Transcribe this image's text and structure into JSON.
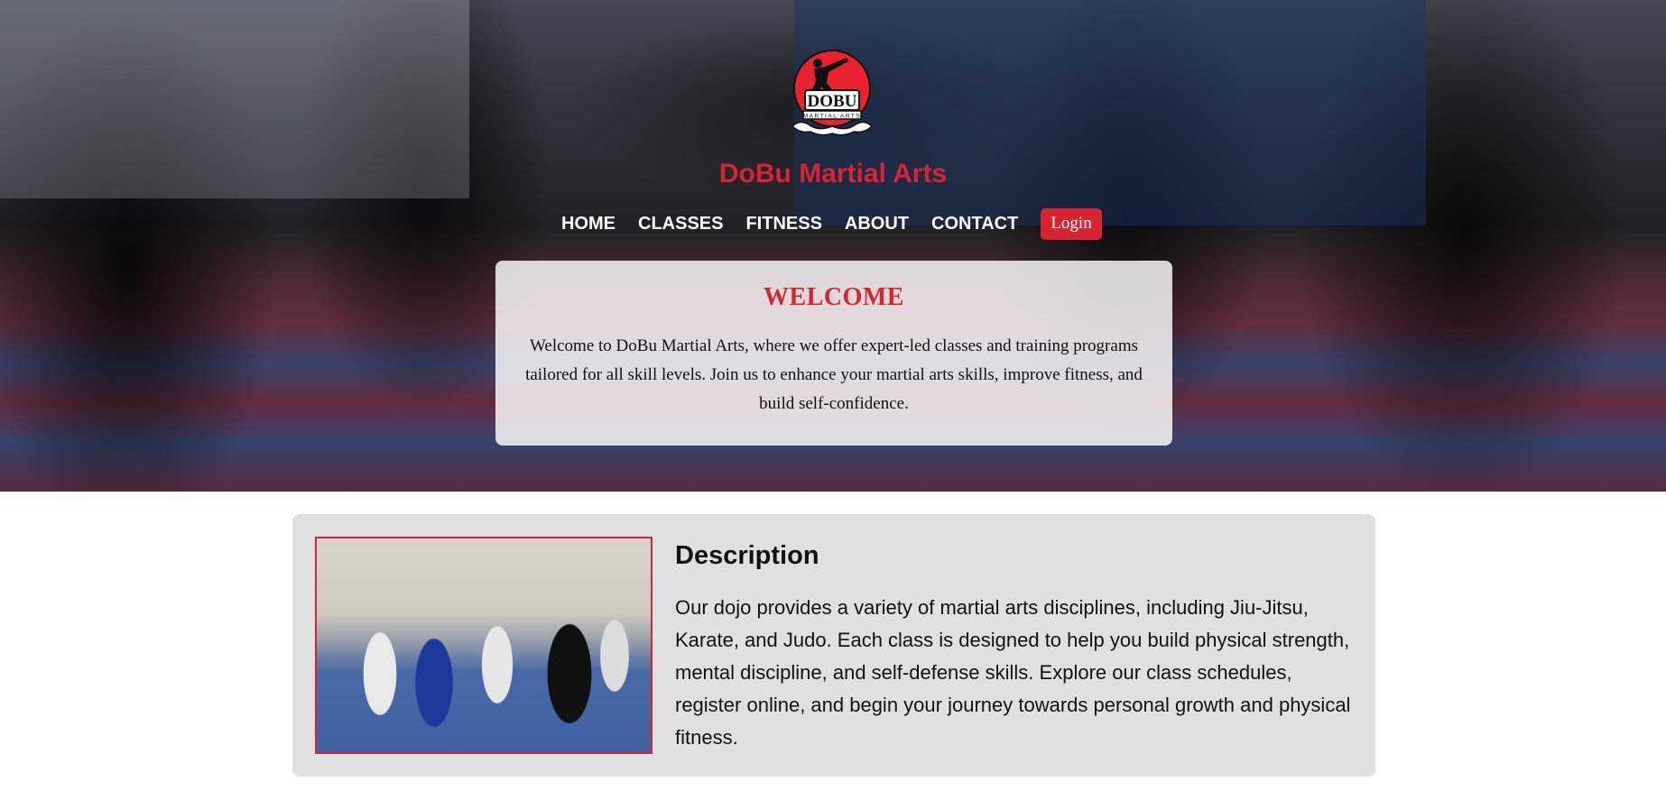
{
  "site": {
    "title": "DoBu Martial Arts",
    "logo": {
      "top_text": "DOBU",
      "bottom_text": "MARTIAL ARTS",
      "icon": "kicking-figure-icon"
    }
  },
  "nav": {
    "items": [
      {
        "label": "HOME"
      },
      {
        "label": "CLASSES"
      },
      {
        "label": "FITNESS"
      },
      {
        "label": "ABOUT"
      },
      {
        "label": "CONTACT"
      }
    ],
    "login_label": "Login"
  },
  "welcome": {
    "title": "WELCOME",
    "text": "Welcome to DoBu Martial Arts, where we offer expert-led classes and training programs tailored for all skill levels. Join us to enhance your martial arts skills, improve fitness, and build self-confidence."
  },
  "description": {
    "heading": "Description",
    "text": "Our dojo provides a variety of martial arts disciplines, including Jiu-Jitsu, Karate, and Judo. Each class is designed to help you build physical strength, mental discipline, and self-defense skills. Explore our class schedules, register online, and begin your journey towards personal growth and physical fitness."
  },
  "colors": {
    "brand_red": "#d62433",
    "card_gray": "#e0e0e0",
    "nav_text": "#ffffff"
  }
}
